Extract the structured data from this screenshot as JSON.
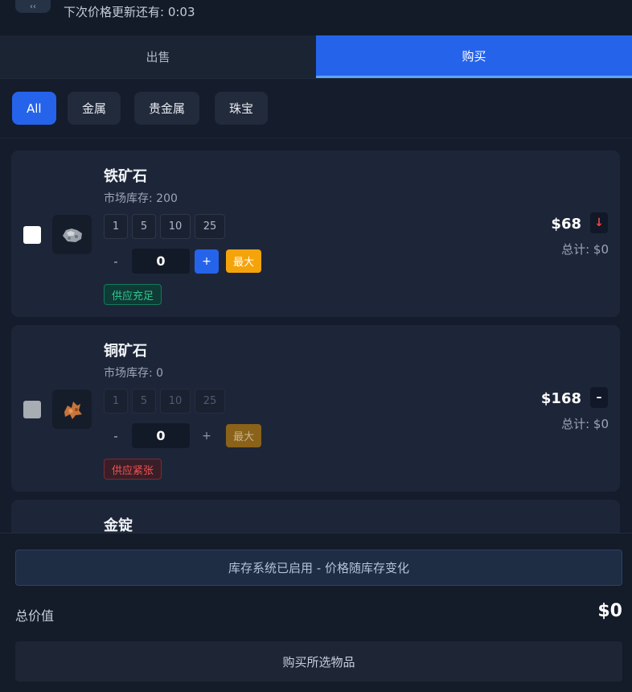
{
  "header": {
    "timer_text": "下次价格更新还有: 0:03"
  },
  "tabs": [
    {
      "label": "出售",
      "active": false
    },
    {
      "label": "购买",
      "active": true
    }
  ],
  "filters": [
    {
      "label": "All",
      "active": true
    },
    {
      "label": "金属",
      "active": false
    },
    {
      "label": "贵金属",
      "active": false
    },
    {
      "label": "珠宝",
      "active": false
    }
  ],
  "quick_amounts": [
    "1",
    "5",
    "10",
    "25"
  ],
  "items": [
    {
      "name": "铁矿石",
      "stock": "市场库存: 200",
      "quantity": "0",
      "minus": "-",
      "plus": "+",
      "max_label": "最大",
      "badge": "供应充足",
      "price": "$68",
      "trend": "↓",
      "row_total": "总计: $0",
      "icon": "iron-ore-icon"
    },
    {
      "name": "铜矿石",
      "stock": "市场库存: 0",
      "quantity": "0",
      "minus": "-",
      "plus": "+",
      "max_label": "最大",
      "badge": "供应紧张",
      "price": "$168",
      "trend": "–",
      "row_total": "总计: $0",
      "icon": "copper-ore-icon"
    },
    {
      "name": "金锭"
    }
  ],
  "footer": {
    "banner": "库存系统已启用 - 价格随库存变化",
    "total_label": "总价值",
    "total_value": "$0",
    "buy_button": "购买所选物品"
  },
  "colors": {
    "accent": "#2563eb",
    "max_button": "#f5a30b",
    "good": "#31c48d",
    "bad": "#f05252"
  }
}
